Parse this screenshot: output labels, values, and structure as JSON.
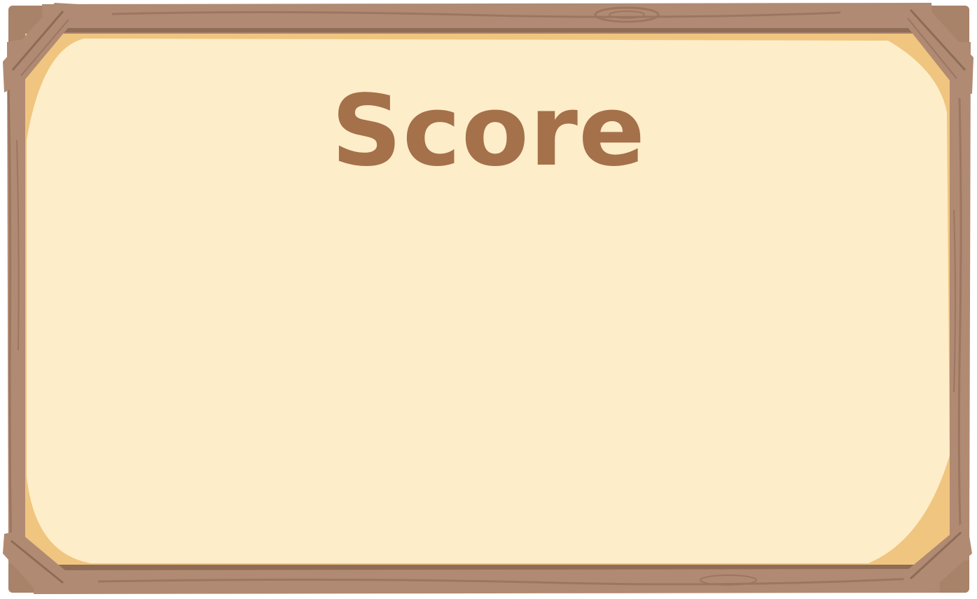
{
  "panel": {
    "title": "Score"
  },
  "colors": {
    "wood": "#b08a72",
    "wood_dark": "#8f6c56",
    "wood_grain": "#9c7660",
    "paper_border": "#f0c57f",
    "paper": "#feedc9",
    "title_text": "#a5714a"
  }
}
